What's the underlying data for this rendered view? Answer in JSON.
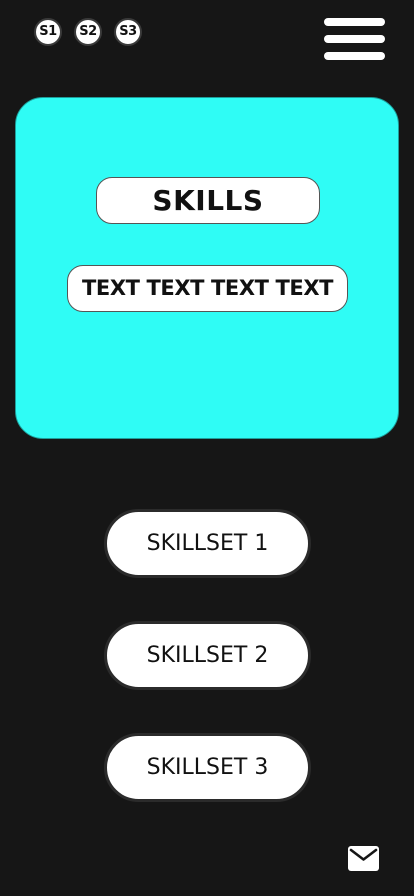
{
  "slide_nav": {
    "items": [
      {
        "label": "S1"
      },
      {
        "label": "S2"
      },
      {
        "label": "S3"
      }
    ]
  },
  "menu": {
    "icon": "hamburger-menu-icon"
  },
  "hero": {
    "background_color": "#2ffcf5",
    "title": "SKILLS",
    "body": "TEXT TEXT TEXT TEXT"
  },
  "skillsets": [
    {
      "label": "SKILLSET 1"
    },
    {
      "label": "SKILLSET 2"
    },
    {
      "label": "SKILLSET 3"
    }
  ],
  "footer": {
    "icon": "mail-icon"
  }
}
